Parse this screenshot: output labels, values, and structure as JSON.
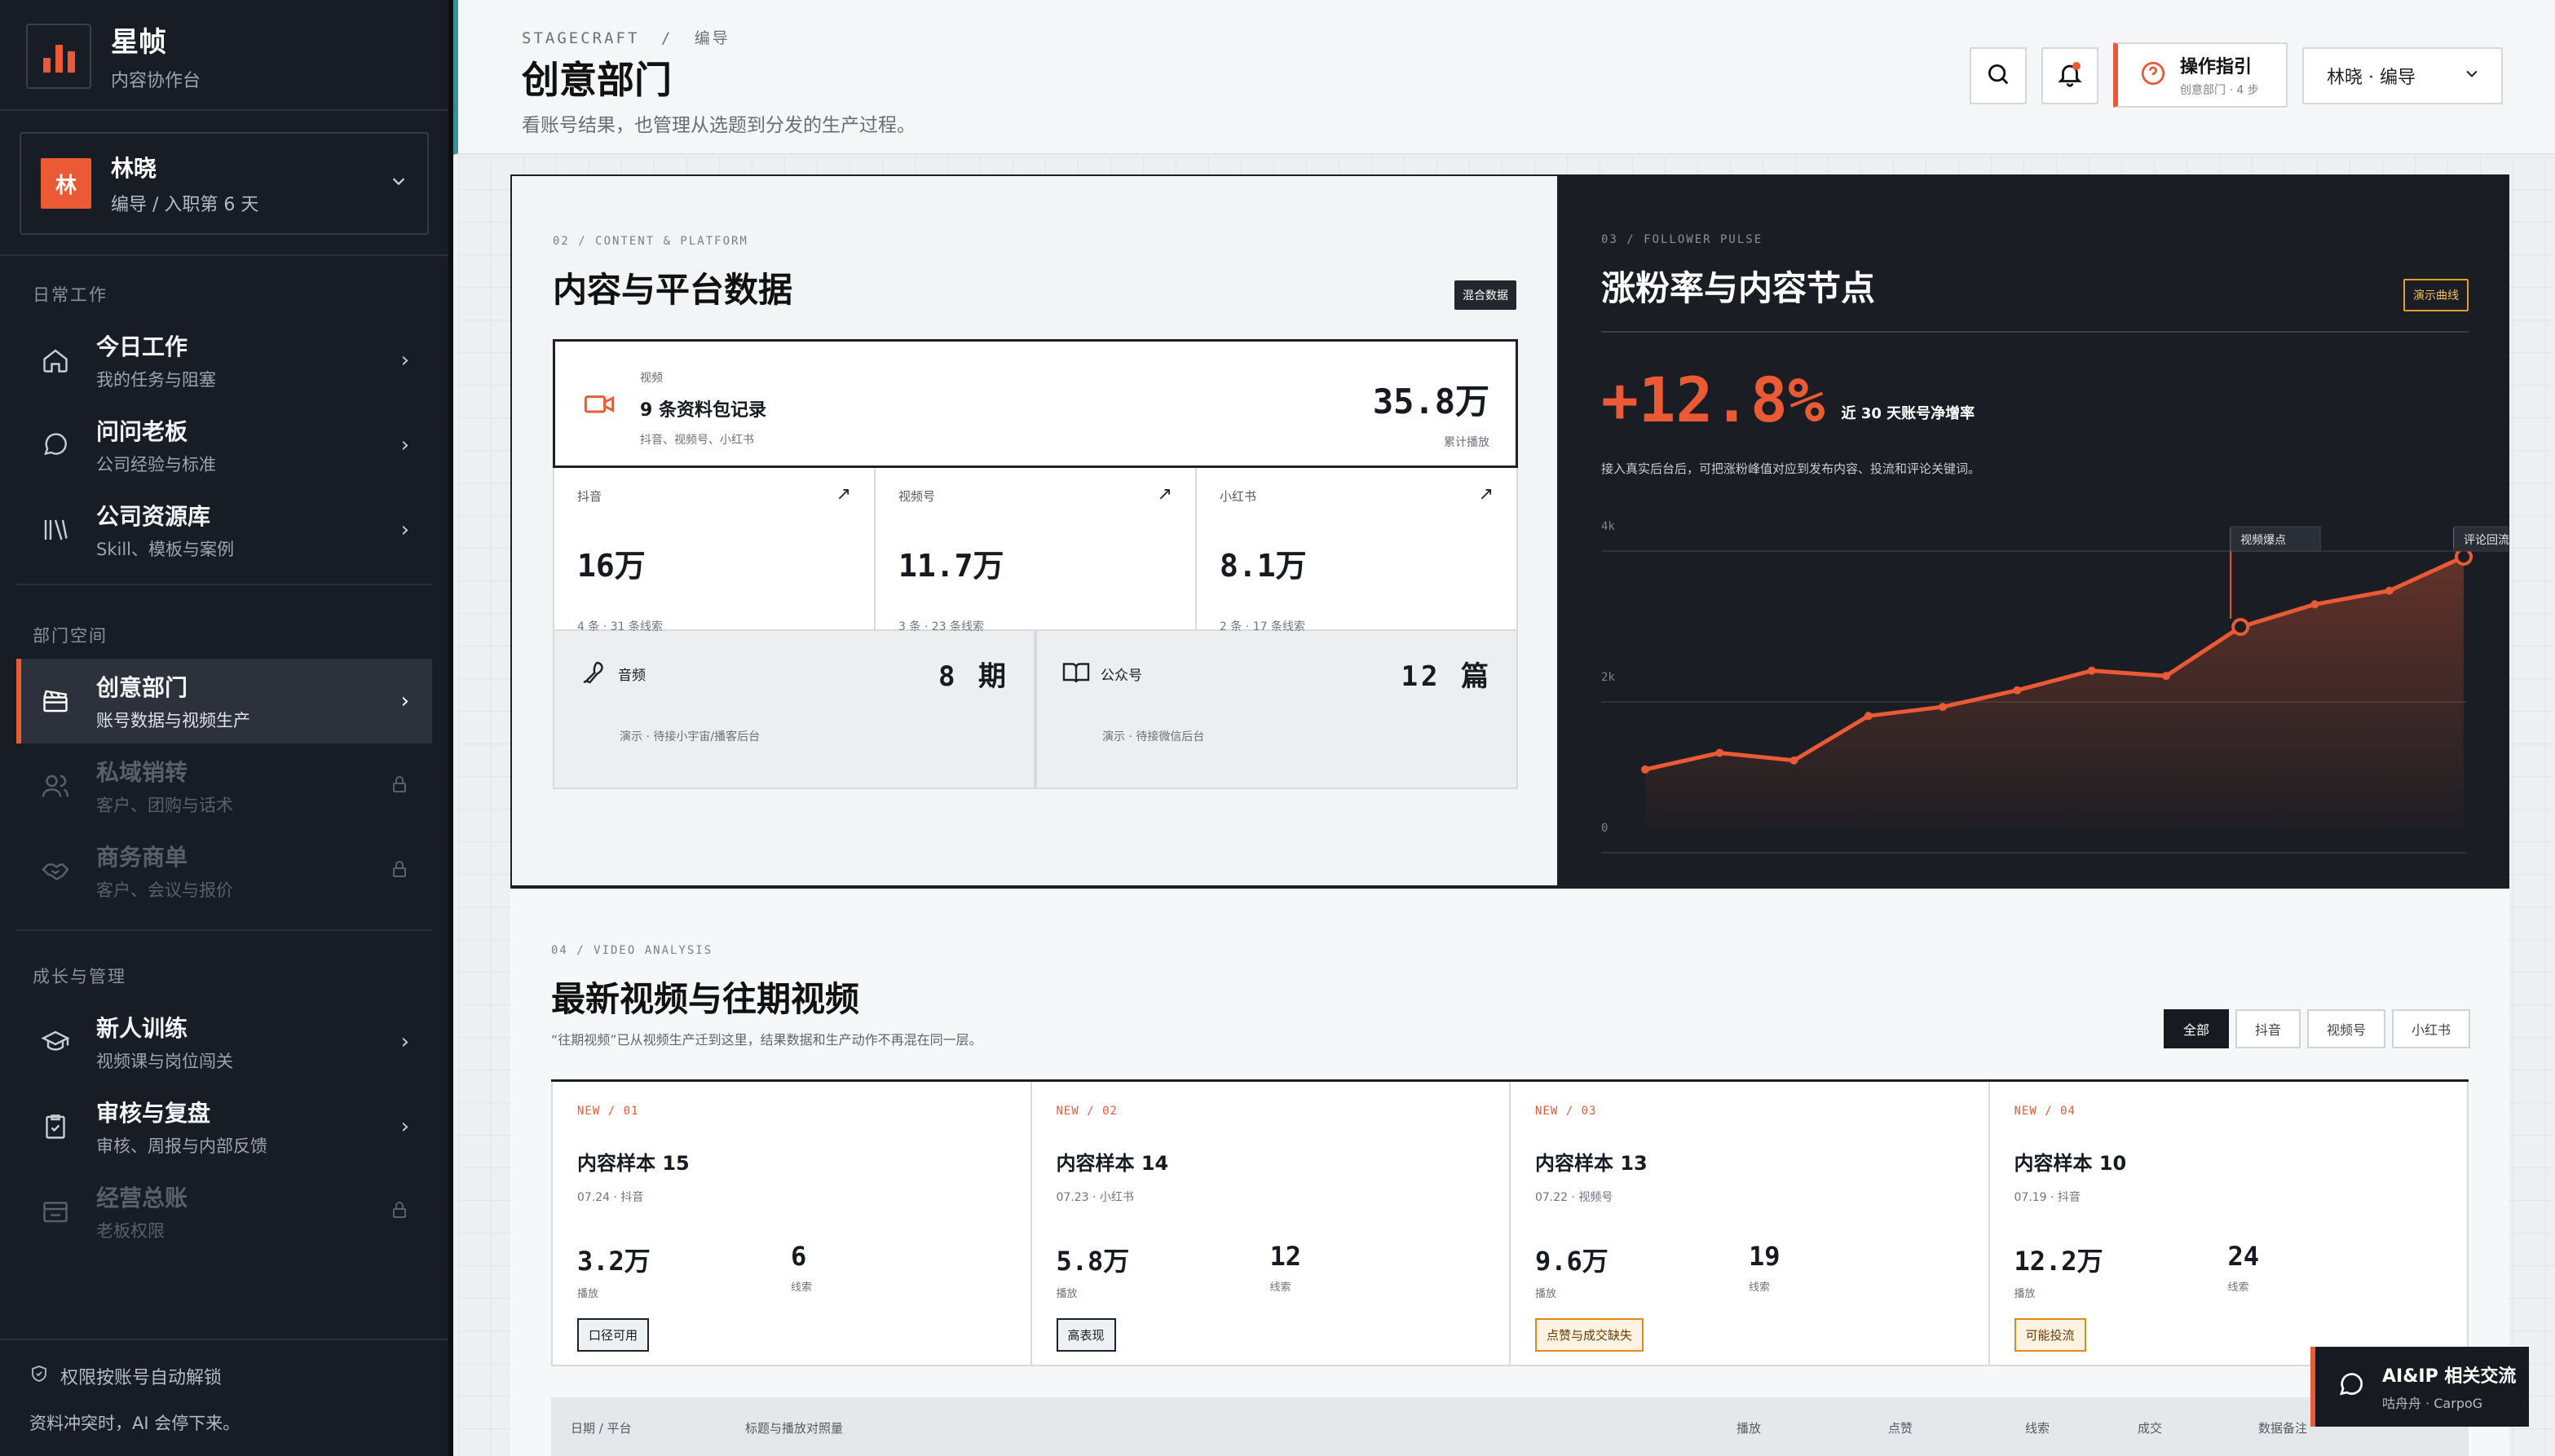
{
  "brand": {
    "name": "星帧",
    "subtitle": "内容协作台"
  },
  "user": {
    "avatar": "林",
    "name": "林晓",
    "role": "编导 / 入职第 6 天"
  },
  "sidebar": {
    "sections": [
      "日常工作",
      "部门空间",
      "成长与管理"
    ],
    "items": [
      {
        "title": "今日工作",
        "sub": "我的任务与阻塞",
        "icon": "home-icon",
        "state": "normal"
      },
      {
        "title": "问问老板",
        "sub": "公司经验与标准",
        "icon": "chat-icon",
        "state": "normal"
      },
      {
        "title": "公司资源库",
        "sub": "Skill、模板与案例",
        "icon": "library-icon",
        "state": "normal"
      },
      {
        "title": "创意部门",
        "sub": "账号数据与视频生产",
        "icon": "clapper-icon",
        "state": "active"
      },
      {
        "title": "私域销转",
        "sub": "客户、团购与话术",
        "icon": "users-icon",
        "state": "locked"
      },
      {
        "title": "商务商单",
        "sub": "客户、会议与报价",
        "icon": "handshake-icon",
        "state": "locked"
      },
      {
        "title": "新人训练",
        "sub": "视频课与岗位闯关",
        "icon": "graduation-icon",
        "state": "normal"
      },
      {
        "title": "审核与复盘",
        "sub": "审核、周报与内部反馈",
        "icon": "clipboard-icon",
        "state": "normal"
      },
      {
        "title": "经营总账",
        "sub": "老板权限",
        "icon": "ledger-icon",
        "state": "locked"
      }
    ],
    "footer_line1": "权限按账号自动解锁",
    "footer_line2": "资料冲突时，AI 会停下来。"
  },
  "header": {
    "breadcrumb_root": "STAGECRAFT",
    "breadcrumb_sep": "/",
    "breadcrumb_current": "编导",
    "title": "创意部门",
    "description": "看账号结果，也管理从选题到分发的生产过程。",
    "guide_title": "操作指引",
    "guide_sub": "创意部门 · 4 步",
    "role_select": "林晓 · 编导"
  },
  "content_panel": {
    "label": "02 / CONTENT & PLATFORM",
    "title": "内容与平台数据",
    "tag": "混合数据",
    "record": {
      "kind": "视频",
      "title": "9 条资料包记录",
      "platforms": "抖音、视频号、小红书",
      "value": "35.8万",
      "value_label": "累计播放"
    },
    "platforms": [
      {
        "name": "抖音",
        "value": "16万",
        "meta": "4 条 · 31 条线索"
      },
      {
        "name": "视频号",
        "value": "11.7万",
        "meta": "3 条 · 23 条线索"
      },
      {
        "name": "小红书",
        "value": "8.1万",
        "meta": "2 条 · 17 条线索"
      }
    ],
    "media": [
      {
        "name": "音频",
        "value": "8 期",
        "meta": "演示 · 待接小宇宙/播客后台",
        "icon": "microphone-icon"
      },
      {
        "name": "公众号",
        "value": "12 篇",
        "meta": "演示 · 待接微信后台",
        "icon": "book-icon"
      }
    ]
  },
  "pulse_panel": {
    "label": "03 / FOLLOWER PULSE",
    "title": "涨粉率与内容节点",
    "tag": "演示曲线",
    "big_value": "+12.8%",
    "big_label": "近 30 天账号净增率",
    "note": "接入真实后台后，可把涨粉峰值对应到发布内容、投流和评论关键词。",
    "markers": [
      "视频爆点",
      "评论回流"
    ]
  },
  "chart_data": {
    "type": "area",
    "title": "涨粉率与内容节点",
    "y_ticks": [
      "4k",
      "2k",
      "0"
    ],
    "ylim": [
      0,
      4000
    ],
    "x": [
      1,
      2,
      3,
      4,
      5,
      6,
      7,
      8,
      9,
      10,
      11,
      12
    ],
    "values": [
      780,
      1000,
      900,
      1490,
      1610,
      1830,
      2090,
      2020,
      2670,
      2970,
      3150,
      3600
    ],
    "annotations": [
      {
        "label": "视频爆点",
        "x": 9
      },
      {
        "label": "评论回流",
        "x": 12
      }
    ],
    "grid": true,
    "color": "#ea5a35"
  },
  "video_panel": {
    "label": "04 / VIDEO ANALYSIS",
    "title": "最新视频与往期视频",
    "description": "“往期视频”已从视频生产迁到这里，结果数据和生产动作不再混在同一层。",
    "filters": [
      "全部",
      "抖音",
      "视频号",
      "小红书"
    ],
    "videos": [
      {
        "tag": "NEW / 01",
        "title": "内容样本 15",
        "meta": "07.24 · 抖音",
        "plays": "3.2万",
        "plays_label": "播放",
        "leads": "6",
        "leads_label": "线索",
        "badge": "口径可用",
        "badge_type": "neutral"
      },
      {
        "tag": "NEW / 02",
        "title": "内容样本 14",
        "meta": "07.23 · 小红书",
        "plays": "5.8万",
        "plays_label": "播放",
        "leads": "12",
        "leads_label": "线索",
        "badge": "高表现",
        "badge_type": "neutral"
      },
      {
        "tag": "NEW / 03",
        "title": "内容样本 13",
        "meta": "07.22 · 视频号",
        "plays": "9.6万",
        "plays_label": "播放",
        "leads": "19",
        "leads_label": "线索",
        "badge": "点赞与成交缺失",
        "badge_type": "warn"
      },
      {
        "tag": "NEW / 04",
        "title": "内容样本 10",
        "meta": "07.19 · 抖音",
        "plays": "12.2万",
        "plays_label": "播放",
        "leads": "24",
        "leads_label": "线索",
        "badge": "可能投流",
        "badge_type": "warn"
      }
    ],
    "table_headers": [
      "日期 / 平台",
      "标题与播放对照量",
      "播放",
      "点赞",
      "线索",
      "成交",
      "数据备注"
    ]
  },
  "chat": {
    "title": "AI&IP 相关交流",
    "subtitle": "咕舟舟 · CarpoG"
  },
  "colors": {
    "accent": "#ea5a35",
    "sidebar_bg": "#181c24",
    "dark_panel": "#1a1d23",
    "teal_rule": "#3b8f96"
  }
}
